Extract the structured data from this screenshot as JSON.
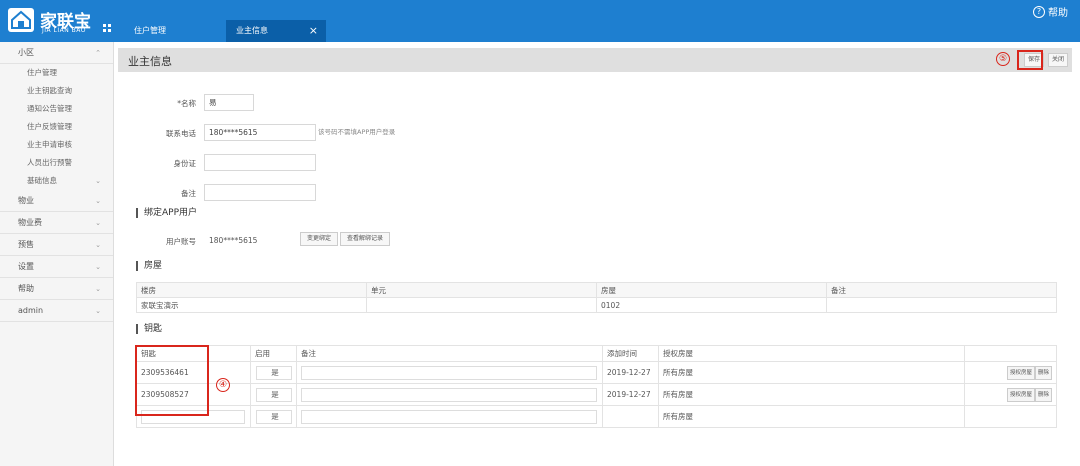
{
  "app": {
    "logo_title": "家联宝",
    "logo_sub": "JIA LIAN BAO",
    "help_label": "帮助",
    "tabs": [
      {
        "label": "住户管理",
        "active": false
      },
      {
        "label": "业主信息",
        "active": true,
        "close": "×"
      }
    ],
    "colors": {
      "topbar": "#1e7fd0",
      "active_tab": "#0b5fa8",
      "annotation": "#d9261c"
    }
  },
  "sidebar": {
    "groups": [
      {
        "label": "小区",
        "expanded": true,
        "items": [
          "住户管理",
          "业主钥匙查询",
          "通知公告管理",
          "住户反馈管理",
          "业主申请审核",
          "人员出行预警",
          "基础信息"
        ]
      },
      {
        "label": "物业"
      },
      {
        "label": "物业费"
      },
      {
        "label": "预售"
      },
      {
        "label": "设置"
      },
      {
        "label": "帮助"
      },
      {
        "label": "admin"
      }
    ]
  },
  "page": {
    "title": "业主信息",
    "save_label": "保存",
    "close_label": "关闭",
    "annotations": {
      "save": "⑤",
      "keys": "④"
    }
  },
  "form": {
    "name_label": "*名称",
    "name_value": "易",
    "phone_label": "联系电话",
    "phone_value": "180****5615",
    "phone_hint": "该号码不需填APP用户登录",
    "idcard_label": "身份证",
    "idcard_value": "",
    "remark_label": "备注",
    "remark_value": ""
  },
  "app_user": {
    "section_title": "绑定APP用户",
    "account_label": "用户账号",
    "account_value": "180****5615",
    "change_btn": "变更绑定",
    "history_btn": "查看解绑记录"
  },
  "house": {
    "section_title": "房屋",
    "columns": [
      "楼房",
      "单元",
      "房屋",
      "备注"
    ],
    "rows": [
      [
        "家联宝演示",
        "",
        "0102",
        ""
      ]
    ]
  },
  "keys": {
    "section_title": "钥匙",
    "columns": [
      "钥匙",
      "启用",
      "备注",
      "添加时间",
      "授权房屋",
      ""
    ],
    "rows": [
      {
        "key": "2309536461",
        "enabled": "是",
        "remark": "",
        "added": "2019-12-27",
        "house": "所有房屋",
        "auth_btn": "授权房屋",
        "del_btn": "删除"
      },
      {
        "key": "2309508527",
        "enabled": "是",
        "remark": "",
        "added": "2019-12-27",
        "house": "所有房屋",
        "auth_btn": "授权房屋",
        "del_btn": "删除"
      },
      {
        "key": "",
        "enabled": "是",
        "remark": "",
        "added": "",
        "house": "所有房屋"
      }
    ]
  }
}
